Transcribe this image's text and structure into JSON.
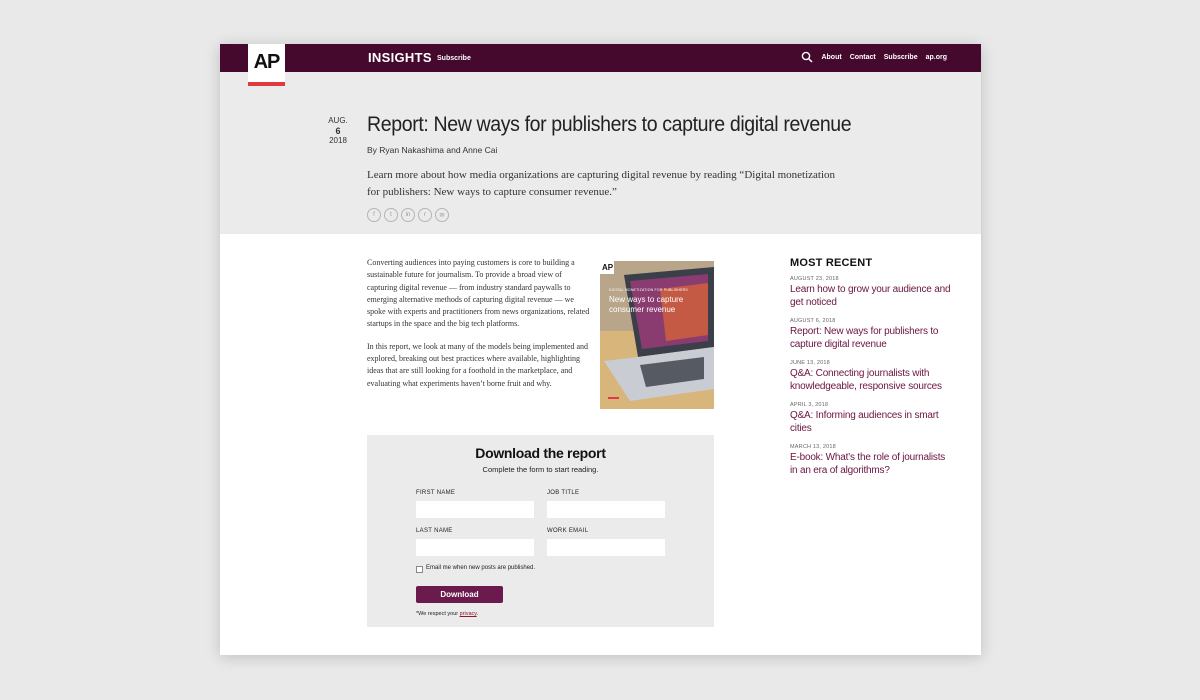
{
  "nav": {
    "logo": "AP",
    "brand": "INSIGHTS",
    "subscribe": "Subscribe",
    "links": [
      "About",
      "Contact",
      "Subscribe",
      "ap.org"
    ]
  },
  "article": {
    "date_month": "AUG.",
    "date_day": "6",
    "date_year": "2018",
    "title": "Report: New ways for publishers to capture digital revenue",
    "byline": "By Ryan Nakashima and Anne Cai",
    "dek": "Learn more about how media organizations are capturing digital revenue by reading “Digital monetization for publishers: New ways to capture consumer revenue.”",
    "share_icons": [
      "facebook-icon",
      "twitter-icon",
      "linkedin-icon",
      "reddit-icon",
      "email-icon"
    ],
    "para1": "Converting audiences into paying customers is core to building a sustainable future for journalism. To provide a broad view of capturing digital revenue — from industry standard paywalls to emerging alternative methods of capturing digital revenue — we spoke with experts and practitioners from news organizations, related startups in the space and the big tech platforms.",
    "para2": "In this report, we look at many of the models being implemented and explored, breaking out best practices where available, highlighting ideas that are still looking for a foothold in the marketplace, and evaluating what experiments haven’t borne fruit and why.",
    "cover_logo": "AP",
    "cover_kicker": "DIGITAL MONETIZATION FOR PUBLISHERS",
    "cover_title_1": "New ways to capture",
    "cover_title_2": "consumer revenue"
  },
  "form": {
    "heading": "Download the report",
    "subheading": "Complete the form to start reading.",
    "first_name_label": "FIRST NAME",
    "job_title_label": "JOB TITLE",
    "last_name_label": "LAST NAME",
    "work_email_label": "WORK EMAIL",
    "checkbox_label": "Email me when new posts are published.",
    "button": "Download",
    "privacy_prefix": "*We respect your ",
    "privacy_link": "privacy",
    "privacy_suffix": "."
  },
  "sidebar": {
    "heading": "MOST RECENT",
    "items": [
      {
        "date": "AUGUST 23, 2018",
        "title": "Learn how to grow your audience and get noticed"
      },
      {
        "date": "AUGUST 6, 2018",
        "title": "Report: New ways for publishers to capture digital revenue"
      },
      {
        "date": "JUNE 13, 2018",
        "title": "Q&A: Connecting journalists with knowledgeable, responsive sources"
      },
      {
        "date": "APRIL 3, 2018",
        "title": "Q&A: Informing audiences in smart cities"
      },
      {
        "date": "MARCH 13, 2018",
        "title": "E-book: What’s the role of journalists in an era of algorithms?"
      }
    ]
  },
  "colors": {
    "nav_bg": "#46092e",
    "link": "#6b1440",
    "button": "#6b1a4d",
    "logo_bar": "#e03a3e"
  }
}
